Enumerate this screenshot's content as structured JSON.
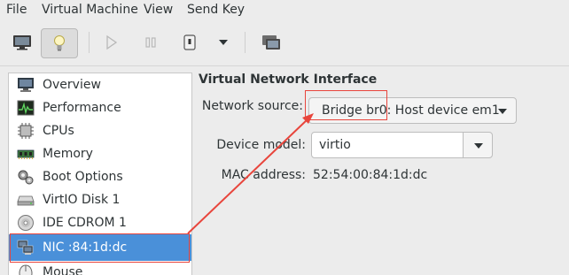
{
  "menubar": {
    "file": "File",
    "virtual_machine": "Virtual Machine",
    "view": "View",
    "send_key": "Send Key"
  },
  "toolbar": {
    "icons": [
      "monitor-icon",
      "lightbulb-icon",
      "play-icon",
      "pause-icon",
      "power-icon",
      "dropdown-icon",
      "screenshot-icon"
    ]
  },
  "sidebar": {
    "items": [
      {
        "label": "Overview",
        "icon": "overview-icon"
      },
      {
        "label": "Performance",
        "icon": "performance-icon"
      },
      {
        "label": "CPUs",
        "icon": "cpu-icon"
      },
      {
        "label": "Memory",
        "icon": "memory-icon"
      },
      {
        "label": "Boot Options",
        "icon": "boot-options-icon"
      },
      {
        "label": "VirtIO Disk 1",
        "icon": "disk-icon"
      },
      {
        "label": "IDE CDROM 1",
        "icon": "cdrom-icon"
      },
      {
        "label": "NIC :84:1d:dc",
        "icon": "nic-icon",
        "selected": true
      },
      {
        "label": "Mouse",
        "icon": "mouse-icon"
      }
    ]
  },
  "detail": {
    "title": "Virtual Network Interface",
    "network_source_label": "Network source:",
    "network_source_value": "Bridge br0: Host device em1",
    "device_model_label": "Device model:",
    "device_model_value": "virtio",
    "mac_label": "MAC address:",
    "mac_value": "52:54:00:84:1d:dc"
  },
  "annotation": {
    "color": "#e8453c"
  }
}
